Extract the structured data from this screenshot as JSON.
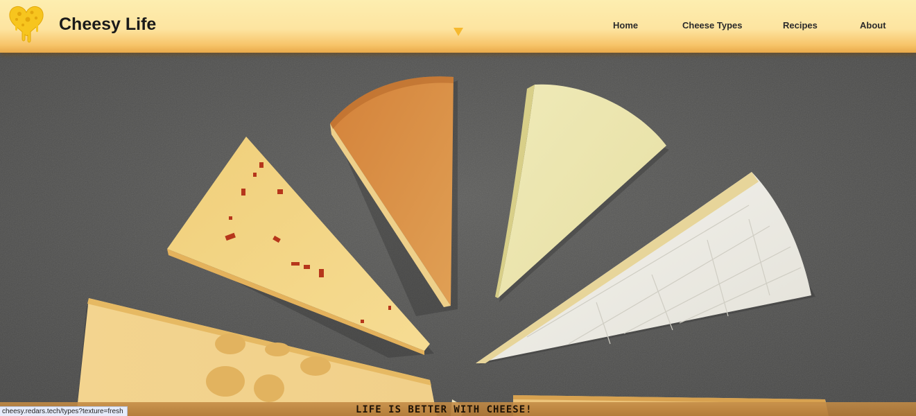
{
  "header": {
    "logo_icon": "melting-cheese-heart-icon",
    "title": "Cheesy Life",
    "dropdown_icon": "triangle-down-icon",
    "nav": {
      "home": "Home",
      "cheese_types": "Cheese Types",
      "recipes": "Recipes",
      "about": "About"
    }
  },
  "hero": {
    "image_subject": "cheese-wedges-photo",
    "tagline": "LIFE IS BETTER WITH CHEESE!"
  },
  "status_bar": {
    "url": "cheesy.redars.tech/types?texture=fresh"
  },
  "colors": {
    "header_top": "#fdeeb0",
    "header_bottom": "#e9a94a",
    "logo_yellow": "#f7c51e",
    "dropdown_arrow": "#f6b92f",
    "slate": "#555555"
  }
}
